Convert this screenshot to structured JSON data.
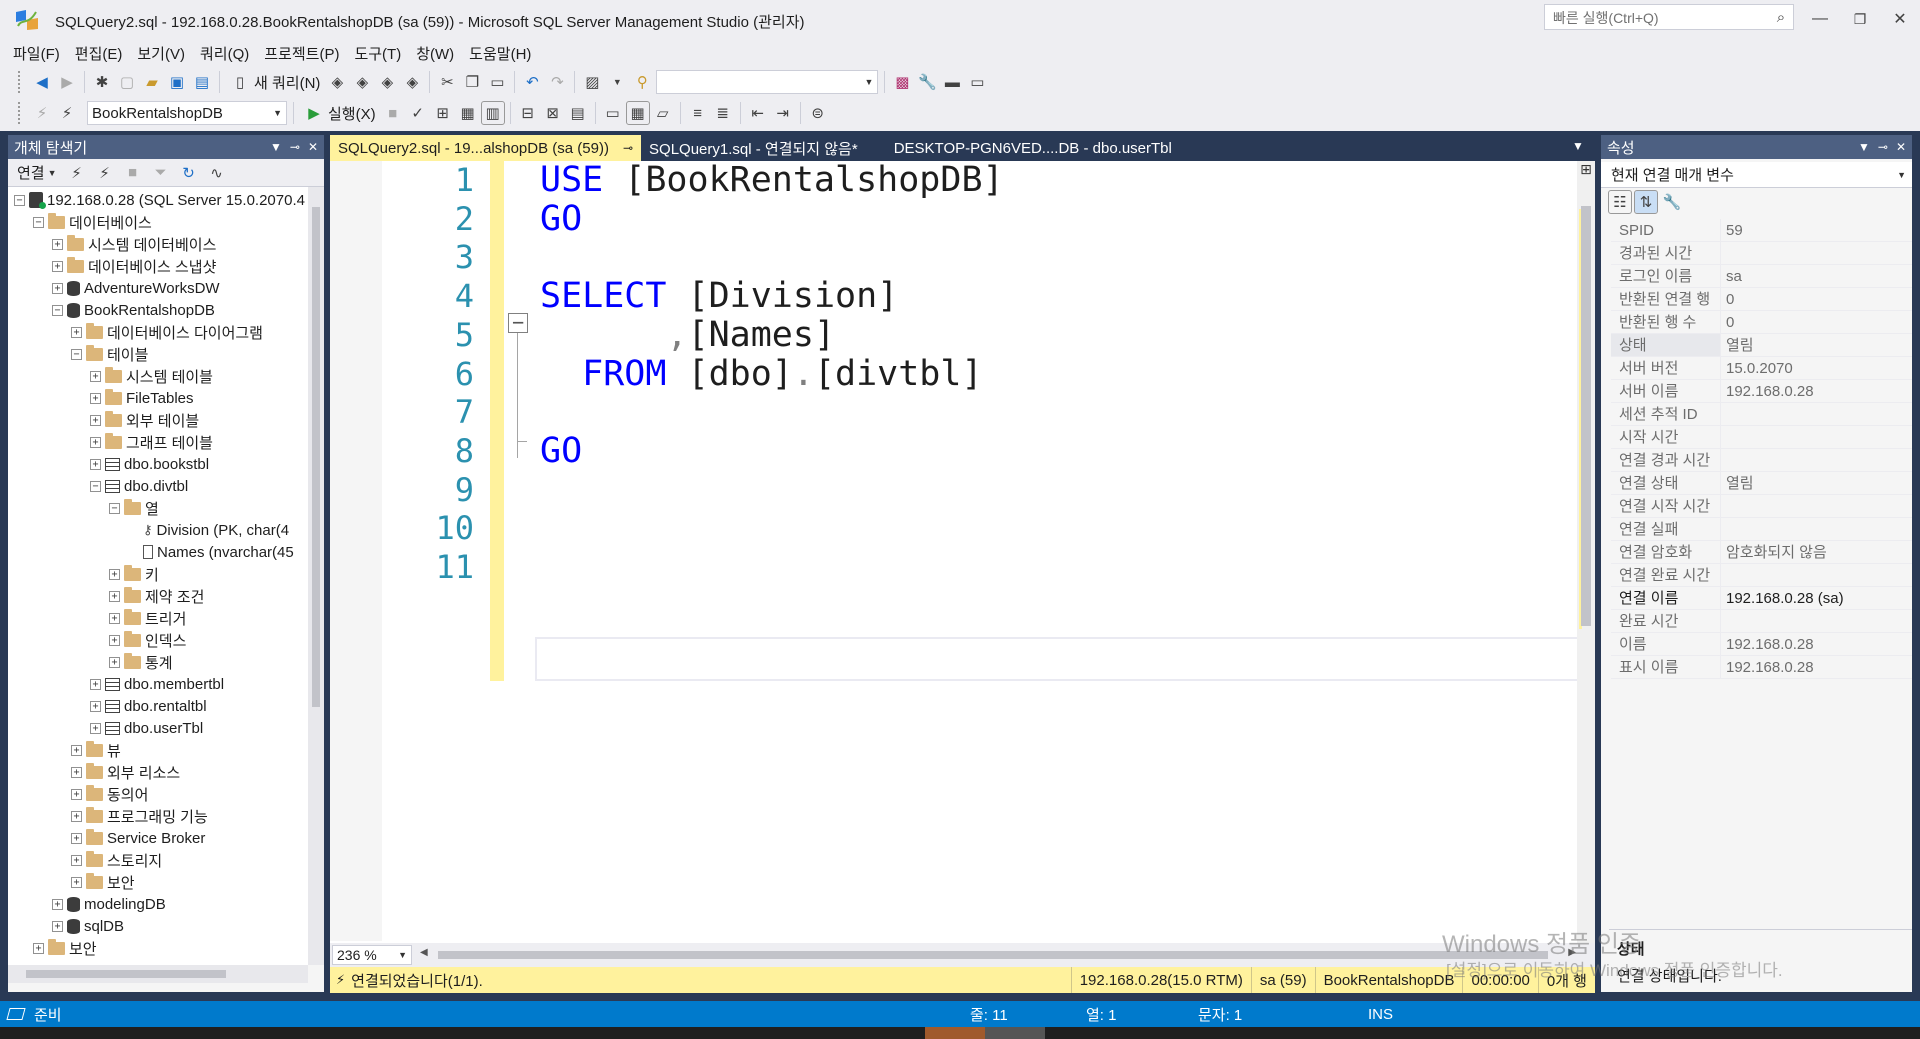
{
  "window": {
    "title": "SQLQuery2.sql - 192.168.0.28.BookRentalshopDB (sa (59)) - Microsoft SQL Server Management Studio (관리자)",
    "quick_launch_placeholder": "빠른 실행(Ctrl+Q)"
  },
  "menu": [
    "파일(F)",
    "편집(E)",
    "보기(V)",
    "쿼리(Q)",
    "프로젝트(P)",
    "도구(T)",
    "창(W)",
    "도움말(H)"
  ],
  "toolbar1": {
    "new_query_label": "새 쿼리(N)",
    "solution_config_value": ""
  },
  "toolbar2": {
    "database_value": "BookRentalshopDB",
    "execute_label": "실행(X)"
  },
  "object_explorer": {
    "title": "개체 탐색기",
    "connect_label": "연결",
    "tree": [
      {
        "text": "192.168.0.28 (SQL Server 15.0.2070.4",
        "level": 0,
        "state": "-",
        "icon": "server"
      },
      {
        "text": "데이터베이스",
        "level": 1,
        "state": "-",
        "icon": "folder"
      },
      {
        "text": "시스템 데이터베이스",
        "level": 2,
        "state": "+",
        "icon": "folder"
      },
      {
        "text": "데이터베이스 스냅샷",
        "level": 2,
        "state": "+",
        "icon": "folder"
      },
      {
        "text": "AdventureWorksDW",
        "level": 2,
        "state": "+",
        "icon": "database"
      },
      {
        "text": "BookRentalshopDB",
        "level": 2,
        "state": "-",
        "icon": "database"
      },
      {
        "text": "데이터베이스 다이어그램",
        "level": 3,
        "state": "+",
        "icon": "folder"
      },
      {
        "text": "테이블",
        "level": 3,
        "state": "-",
        "icon": "folder"
      },
      {
        "text": "시스템 테이블",
        "level": 4,
        "state": "+",
        "icon": "folder"
      },
      {
        "text": "FileTables",
        "level": 4,
        "state": "+",
        "icon": "folder"
      },
      {
        "text": "외부 테이블",
        "level": 4,
        "state": "+",
        "icon": "folder"
      },
      {
        "text": "그래프 테이블",
        "level": 4,
        "state": "+",
        "icon": "folder"
      },
      {
        "text": "dbo.bookstbl",
        "level": 4,
        "state": "+",
        "icon": "table"
      },
      {
        "text": "dbo.divtbl",
        "level": 4,
        "state": "-",
        "icon": "table"
      },
      {
        "text": "열",
        "level": 5,
        "state": "-",
        "icon": "folder"
      },
      {
        "text": "Division (PK, char(4",
        "level": 6,
        "state": "",
        "icon": "key"
      },
      {
        "text": "Names (nvarchar(45",
        "level": 6,
        "state": "",
        "icon": "column"
      },
      {
        "text": "키",
        "level": 5,
        "state": "+",
        "icon": "folder"
      },
      {
        "text": "제약 조건",
        "level": 5,
        "state": "+",
        "icon": "folder"
      },
      {
        "text": "트리거",
        "level": 5,
        "state": "+",
        "icon": "folder"
      },
      {
        "text": "인덱스",
        "level": 5,
        "state": "+",
        "icon": "folder"
      },
      {
        "text": "통계",
        "level": 5,
        "state": "+",
        "icon": "folder"
      },
      {
        "text": "dbo.membertbl",
        "level": 4,
        "state": "+",
        "icon": "table"
      },
      {
        "text": "dbo.rentaltbl",
        "level": 4,
        "state": "+",
        "icon": "table"
      },
      {
        "text": "dbo.userTbl",
        "level": 4,
        "state": "+",
        "icon": "table"
      },
      {
        "text": "뷰",
        "level": 3,
        "state": "+",
        "icon": "folder"
      },
      {
        "text": "외부 리소스",
        "level": 3,
        "state": "+",
        "icon": "folder"
      },
      {
        "text": "동의어",
        "level": 3,
        "state": "+",
        "icon": "folder"
      },
      {
        "text": "프로그래밍 기능",
        "level": 3,
        "state": "+",
        "icon": "folder"
      },
      {
        "text": "Service Broker",
        "level": 3,
        "state": "+",
        "icon": "folder"
      },
      {
        "text": "스토리지",
        "level": 3,
        "state": "+",
        "icon": "folder"
      },
      {
        "text": "보안",
        "level": 3,
        "state": "+",
        "icon": "folder"
      },
      {
        "text": "modelingDB",
        "level": 2,
        "state": "+",
        "icon": "database"
      },
      {
        "text": "sqlDB",
        "level": 2,
        "state": "+",
        "icon": "database"
      },
      {
        "text": "보안",
        "level": 1,
        "state": "+",
        "icon": "folder"
      }
    ]
  },
  "tabs": [
    {
      "label": "SQLQuery2.sql - 19...alshopDB (sa (59))",
      "pin": "⊸",
      "state": "active"
    },
    {
      "label": "SQLQuery1.sql - 연결되지 않음*",
      "state": "inactive"
    },
    {
      "label": "DESKTOP-PGN6VED....DB - dbo.userTbl",
      "state": "preview"
    }
  ],
  "editor": {
    "line_numbers": [
      "1",
      "2",
      "3",
      "4",
      "5",
      "6",
      "7",
      "8",
      "9",
      "10",
      "11"
    ],
    "lines": [
      [
        {
          "t": "USE",
          "c": "kw"
        },
        {
          "t": " [BookRentalshopDB]",
          "c": ""
        }
      ],
      [
        {
          "t": "GO",
          "c": "kw"
        }
      ],
      [],
      [
        {
          "t": "SELECT",
          "c": "kw"
        },
        {
          "t": " [Division]",
          "c": ""
        }
      ],
      [
        {
          "t": "      ",
          "c": ""
        },
        {
          "t": ",",
          "c": "pun"
        },
        {
          "t": "[Names]",
          "c": ""
        }
      ],
      [
        {
          "t": "  FROM",
          "c": "kw"
        },
        {
          "t": " [dbo]",
          "c": ""
        },
        {
          "t": ".",
          "c": "pun"
        },
        {
          "t": "[divtbl]",
          "c": ""
        }
      ],
      [],
      [
        {
          "t": "GO",
          "c": "kw"
        }
      ],
      [],
      [],
      []
    ],
    "zoom": "236 %"
  },
  "query_status": {
    "message": "연결되었습니다(1/1).",
    "server": "192.168.0.28(15.0 RTM)",
    "user": "sa (59)",
    "database": "BookRentalshopDB",
    "elapsed": "00:00:00",
    "rows": "0개 행"
  },
  "properties": {
    "title": "속성",
    "selected_object": "현재 연결 매개 변수",
    "rows": [
      {
        "name": "SPID",
        "value": "59"
      },
      {
        "name": "경과된 시간",
        "value": ""
      },
      {
        "name": "로그인 이름",
        "value": "sa"
      },
      {
        "name": "반환된 연결 행",
        "value": "0"
      },
      {
        "name": "반환된 행 수",
        "value": "0"
      },
      {
        "name": "상태",
        "value": "열림"
      },
      {
        "name": "서버 버전",
        "value": "15.0.2070"
      },
      {
        "name": "서버 이름",
        "value": "192.168.0.28"
      },
      {
        "name": "세션 추적 ID",
        "value": ""
      },
      {
        "name": "시작 시간",
        "value": ""
      },
      {
        "name": "연결 경과 시간",
        "value": ""
      },
      {
        "name": "연결 상태",
        "value": "열림"
      },
      {
        "name": "연결 시작 시간",
        "value": ""
      },
      {
        "name": "연결 실패",
        "value": ""
      },
      {
        "name": "연결 암호화",
        "value": "암호화되지 않음"
      },
      {
        "name": "연결 완료 시간",
        "value": ""
      },
      {
        "name": "연결 이름",
        "value": "192.168.0.28 (sa)"
      },
      {
        "name": "완료 시간",
        "value": ""
      },
      {
        "name": "이름",
        "value": "192.168.0.28"
      },
      {
        "name": "표시 이름",
        "value": "192.168.0.28"
      }
    ],
    "desc_title": "상태",
    "desc_text": "연결 상태입니다."
  },
  "watermark": {
    "line1": "Windows 정품 인증",
    "line2": "[설정]으로 이동하여 Windows 정품 인증합니다."
  },
  "statusbar": {
    "ready": "준비",
    "line": "줄: 11",
    "col": "열: 1",
    "char": "문자: 1",
    "mode": "INS"
  },
  "colors": {
    "accent": "#007acc",
    "panel_header": "#4d6082",
    "dock": "#293955",
    "active_tab": "#fff29d",
    "keyword": "#0000ff",
    "line_number": "#2b91af"
  }
}
